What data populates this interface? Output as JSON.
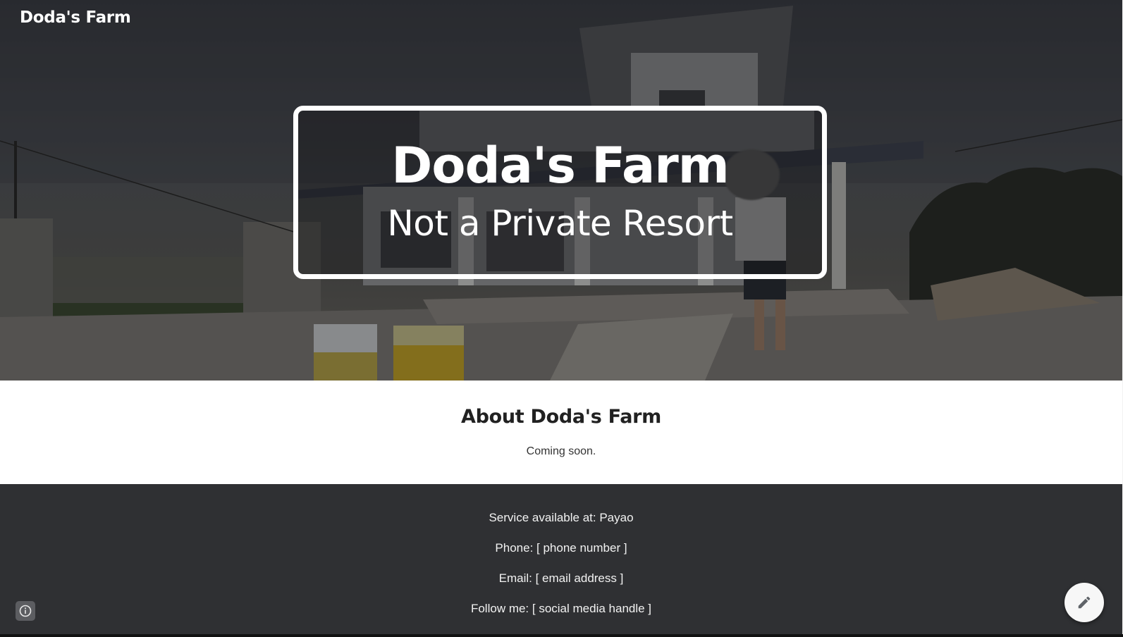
{
  "site": {
    "title": "Doda's Farm"
  },
  "hero": {
    "title": "Doda's Farm",
    "subtitle": "Not a Private Resort"
  },
  "about": {
    "heading": "About Doda's Farm",
    "text": "Coming soon."
  },
  "footer": {
    "service": "Service available at:  Payao",
    "phone": "Phone: [ phone number ]",
    "email": "Email: [ email address ]",
    "social": "Follow me: [ social media handle ]"
  },
  "icons": {
    "info": "info-icon",
    "edit": "pencil-icon"
  },
  "colors": {
    "footer_bg": "#2f3033",
    "text_dark": "#212121",
    "hero_text": "#ffffff"
  }
}
